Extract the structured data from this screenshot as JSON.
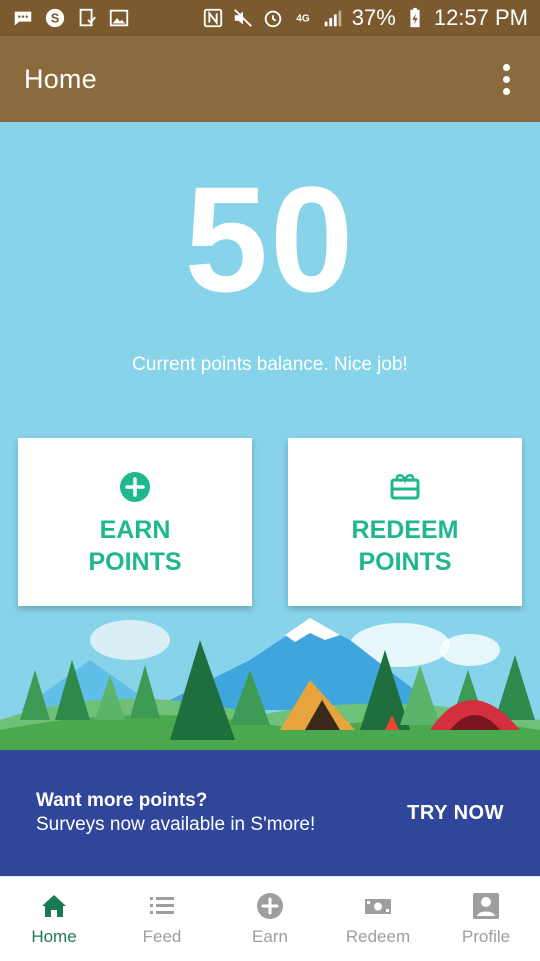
{
  "status_bar": {
    "battery": "37%",
    "time": "12:57 PM",
    "left_icons": [
      "chat-notification-icon",
      "skype-icon",
      "download-icon",
      "image-icon"
    ],
    "right_icons": [
      "nfc-icon",
      "mute-icon",
      "alarm-icon",
      "4g-icon",
      "signal-icon",
      "battery-charging-icon"
    ]
  },
  "app_bar": {
    "title": "Home",
    "menu_icon": "overflow-menu-icon"
  },
  "points": {
    "value": "50",
    "caption": "Current points balance. Nice job!"
  },
  "cards": {
    "earn": {
      "label": "EARN\nPOINTS",
      "icon": "plus-circle-icon"
    },
    "redeem": {
      "label": "REDEEM\nPOINTS",
      "icon": "gift-card-icon"
    }
  },
  "banner": {
    "title": "Want more points?",
    "subtitle": "Surveys now available in S'more!",
    "cta": "TRY NOW"
  },
  "bottom_nav": {
    "items": [
      {
        "label": "Home",
        "icon": "home-icon",
        "active": true
      },
      {
        "label": "Feed",
        "icon": "list-icon",
        "active": false
      },
      {
        "label": "Earn",
        "icon": "add-circle-icon",
        "active": false
      },
      {
        "label": "Redeem",
        "icon": "cash-icon",
        "active": false
      },
      {
        "label": "Profile",
        "icon": "profile-icon",
        "active": false
      }
    ]
  },
  "colors": {
    "status_bar": "#7c5a2f",
    "app_bar": "#8b6a3e",
    "background": "#87d3ea",
    "accent": "#1fb78d",
    "banner": "#30469b",
    "nav_active": "#1a7a56",
    "nav_inactive": "#9e9e9e"
  }
}
